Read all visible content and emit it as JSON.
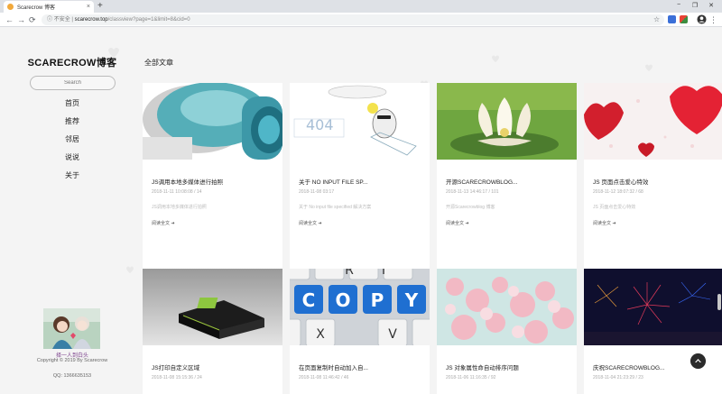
{
  "browser": {
    "tab_title": "Scarecrow 博客",
    "tab_close": "×",
    "new_tab": "+",
    "window": {
      "minimize": "−",
      "maximize": "❐",
      "close": "✕"
    },
    "nav": {
      "back": "←",
      "forward": "→",
      "reload": "⟳",
      "info": "ⓘ"
    },
    "security_label": "不安全",
    "url_host": "scarecrow.top",
    "url_path": "/classview?page=1&limit=8&cid=0",
    "bookmark_star": "☆"
  },
  "sidebar": {
    "site_title": "SCARECROW博客",
    "search_placeholder": "Search",
    "nav_items": [
      "首页",
      "推荐",
      "邻居",
      "说说",
      "关于"
    ],
    "motto": "择一人到白头",
    "copyright": "Copyright © 2019 By Scarecrow",
    "qq": "QQ:  1366635153"
  },
  "main": {
    "section_title": "全部文章",
    "articles": [
      {
        "title": "JS调用本地多媒体进行拍照",
        "meta": "2018-11-11 10:08:08 / 14",
        "desc": "JS调用本地多媒体进行拍照",
        "more": "阅读全文 ➜"
      },
      {
        "title": "关于 NO INPUT FILE SP...",
        "meta": "2018-11-08 03:17",
        "desc": "关于 No input file specified 解决方案",
        "more": "阅读全文 ➜"
      },
      {
        "title": "开源SCARECROWBLOG...",
        "meta": "2018-11-13 14:46:17 / 101",
        "desc": "开源Scarecrowblog 博客",
        "more": "阅读全文 ➜"
      },
      {
        "title": "JS 页面点击爱心特效",
        "meta": "2018-11-12 18:07:32 / 68",
        "desc": "JS 页面点击爱心特效",
        "more": "阅读全文 ➜"
      },
      {
        "title": "JS打印自定义区域",
        "meta": "2018-11-08 15:15:36 / 24"
      },
      {
        "title": "在页面复制时自动加入自...",
        "meta": "2018-11-08 11:46:42 / 46"
      },
      {
        "title": "JS 对象属性命自动排序问题",
        "meta": "2018-11-06 11:16:35 / 92"
      },
      {
        "title": "庆祝SCARECROWBLOG...",
        "meta": "2018-11-04 21:23:29 / 23"
      }
    ]
  },
  "colors": {
    "page_bg": "#f4f4f4",
    "card_bg": "#ffffff",
    "motto": "#7a3f8a"
  },
  "icons": [
    "search-icon",
    "heart-icon",
    "arrow-right-icon",
    "scroll-top-icon",
    "star-icon",
    "profile-icon"
  ]
}
